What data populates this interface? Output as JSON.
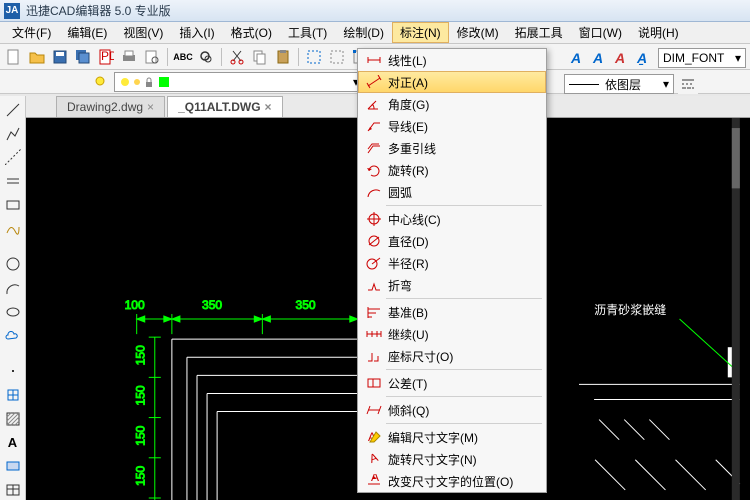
{
  "titlebar": {
    "app_title": "迅捷CAD编辑器 5.0 专业版"
  },
  "menubar": {
    "items": [
      "文件(F)",
      "编辑(E)",
      "视图(V)",
      "插入(I)",
      "格式(O)",
      "工具(T)",
      "绘制(D)",
      "标注(N)",
      "修改(M)",
      "拓展工具",
      "窗口(W)",
      "说明(H)"
    ],
    "open_index": 7
  },
  "layer_row": {
    "layer_combo_text": "",
    "bylayer_text": "依图层"
  },
  "dim_style": {
    "value": "DIM_FONT"
  },
  "tabs": [
    {
      "label": "Drawing2.dwg",
      "active": false
    },
    {
      "label": "_Q11ALT.DWG",
      "active": true
    }
  ],
  "dropdown": {
    "items": [
      {
        "icon": "linear",
        "label": "线性(L)"
      },
      {
        "icon": "aligned",
        "label": "对正(A)",
        "highlight": true
      },
      {
        "icon": "angular",
        "label": "角度(G)"
      },
      {
        "icon": "leader",
        "label": "导线(E)"
      },
      {
        "icon": "mleader",
        "label": "多重引线"
      },
      {
        "icon": "rotate",
        "label": "旋转(R)"
      },
      {
        "icon": "arc",
        "label": "圆弧"
      },
      {
        "sep": true
      },
      {
        "icon": "center",
        "label": "中心线(C)"
      },
      {
        "icon": "diameter",
        "label": "直径(D)"
      },
      {
        "icon": "radius",
        "label": "半径(R)"
      },
      {
        "icon": "jog",
        "label": "折弯"
      },
      {
        "sep": true
      },
      {
        "icon": "baseline",
        "label": "基准(B)"
      },
      {
        "icon": "continue",
        "label": "继续(U)"
      },
      {
        "icon": "ordinate",
        "label": "座标尺寸(O)"
      },
      {
        "sep": true
      },
      {
        "icon": "tolerance",
        "label": "公差(T)"
      },
      {
        "sep": true
      },
      {
        "icon": "oblique",
        "label": "倾斜(Q)"
      },
      {
        "sep": true
      },
      {
        "icon": "textedit",
        "label": "编辑尺寸文字(M)"
      },
      {
        "icon": "rotatetext",
        "label": "旋转尺寸文字(N)"
      },
      {
        "icon": "reposition",
        "label": "改变尺寸文字的位置(O)"
      }
    ]
  },
  "canvas": {
    "dims": [
      "100",
      "350",
      "350"
    ],
    "vdims": [
      "150",
      "150",
      "150",
      "150"
    ],
    "annotation": "沥青砂浆嵌缝"
  }
}
